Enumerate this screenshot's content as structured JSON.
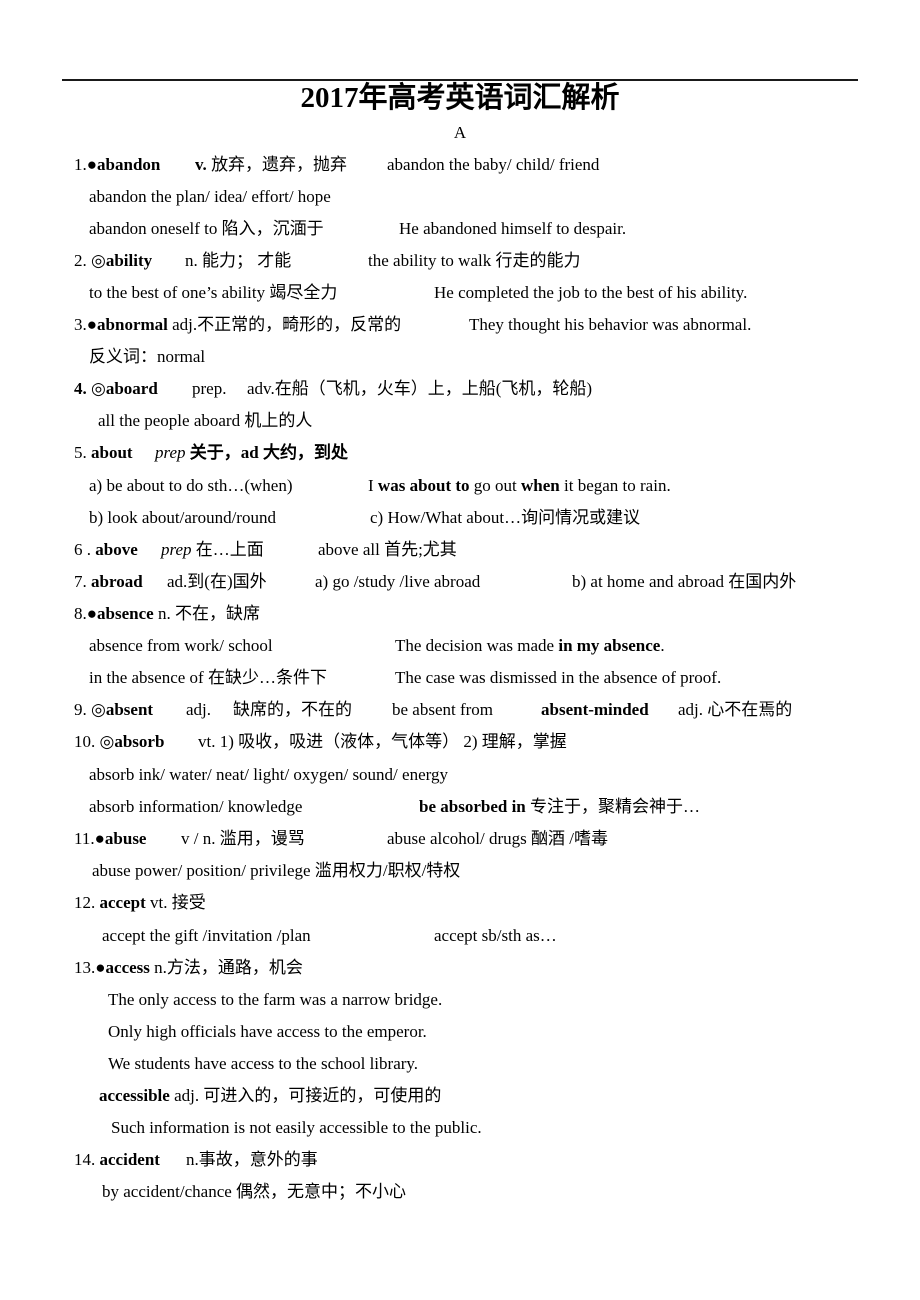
{
  "document": {
    "title": "2017年高考英语词汇解析",
    "section_letter": "A"
  },
  "entries": {
    "e1": {
      "num": "1.",
      "mark": "●",
      "word": "abandon",
      "pos": "v.",
      "meaning": "放弃，遗弃，抛弃",
      "example": "abandon the baby/ child/ friend",
      "line2": "abandon the plan/ idea/ effort/ hope",
      "line3_phrase": "abandon oneself to  陷入，沉湎于",
      "line3_sentence": "He abandoned himself to despair."
    },
    "e2": {
      "num": "2.",
      "mark": "◎",
      "word": "ability",
      "pos": "n.",
      "meaning": "能力；   才能",
      "example": "the ability to walk  行走的能力",
      "line2_phrase": "to the best of one’s ability   竭尽全力",
      "line2_sentence": "He completed the job to the best of his ability."
    },
    "e3": {
      "num": "3.",
      "mark": "●",
      "word": "abnormal",
      "rest": "adj.不正常的，畸形的，反常的",
      "example": "They thought his behavior was abnormal.",
      "line2": "反义词：normal"
    },
    "e4": {
      "num": "4.",
      "mark": "◎",
      "word": "aboard",
      "pos": "prep.",
      "meaning": "adv.在船（飞机，火车）上，上船(飞机，轮船)",
      "line2": "all the people aboard   机上的人"
    },
    "e5": {
      "num": "5.",
      "word": "about",
      "pos": "prep",
      "meaning1": "关于，",
      "pos2": "ad",
      "meaning2": " 大约，到处",
      "a_phrase": "a) be about to do sth…(when)",
      "a_sentence": {
        "p1": "I ",
        "b1": "was about to",
        "p2": " go out ",
        "b2": "when",
        "p3": " it began to rain."
      },
      "b_phrase": "b) look about/around/round",
      "c_phrase": "c) How/What about…询问情况或建议"
    },
    "e6": {
      "num": "6 .",
      "word": "above",
      "pos": "prep",
      "meaning": "在…上面",
      "phrase": "above all  首先;尤其"
    },
    "e7": {
      "num": "7.",
      "word": "abroad",
      "meaning": "ad.到(在)国外",
      "a": "a) go /study /live abroad",
      "b": "b) at home and abroad 在国内外"
    },
    "e8": {
      "num": "8.",
      "mark": "●",
      "word": "absence",
      "meaning": "n.  不在，缺席",
      "line2_phrase": "absence from work/ school",
      "line2_sentence": {
        "p1": "The decision was made ",
        "b1": "in my absence",
        "p2": "."
      },
      "line3_phrase": "in the absence of  在缺少…条件下",
      "line3_sentence": "The case was dismissed in the absence of proof."
    },
    "e9": {
      "num": "9.",
      "mark": "◎",
      "word": "absent",
      "pos": "adj.",
      "meaning": "缺席的，不在的",
      "phrase": "be absent from",
      "related_word": "absent-minded",
      "related_meaning": "adj.  心不在焉的"
    },
    "e10": {
      "num": "10.",
      "mark": "◎",
      "word": "absorb",
      "meaning": "vt. 1)  吸收，吸进（液体，气体等）  2)  理解，掌握",
      "line2": "absorb ink/ water/ neat/ light/ oxygen/ sound/ energy",
      "line3_phrase": "absorb information/ knowledge",
      "line3_bold": "be absorbed in",
      "line3_meaning": " 专注于，聚精会神于…"
    },
    "e11": {
      "num": "11.",
      "mark": "●",
      "word": "abuse",
      "meaning": "v / n.  滥用，谩骂",
      "example": "abuse alcohol/ drugs  酗酒  /嗜毒",
      "line2": "abuse power/ position/ privilege  滥用权力/职权/特权"
    },
    "e12": {
      "num": "12.",
      "word": "accept",
      "meaning": "vt.  接受",
      "line2_a": "accept the gift /invitation /plan",
      "line2_b": "accept sb/sth as…"
    },
    "e13": {
      "num": "13.",
      "mark": "●",
      "word": "access",
      "meaning": "n.方法，通路，机会",
      "examples": [
        "The only access to the farm was a narrow bridge.",
        "Only high officials have access to the emperor.",
        "We students have access to the school library."
      ],
      "derived_word": "accessible",
      "derived_meaning": "adj.  可进入的，可接近的，可使用的",
      "derived_example": "Such information is not easily accessible to the public."
    },
    "e14": {
      "num": "14.",
      "word": "accident",
      "meaning": "n.事故，意外的事",
      "line2": "by accident/chance  偶然，无意中；不小心"
    }
  }
}
